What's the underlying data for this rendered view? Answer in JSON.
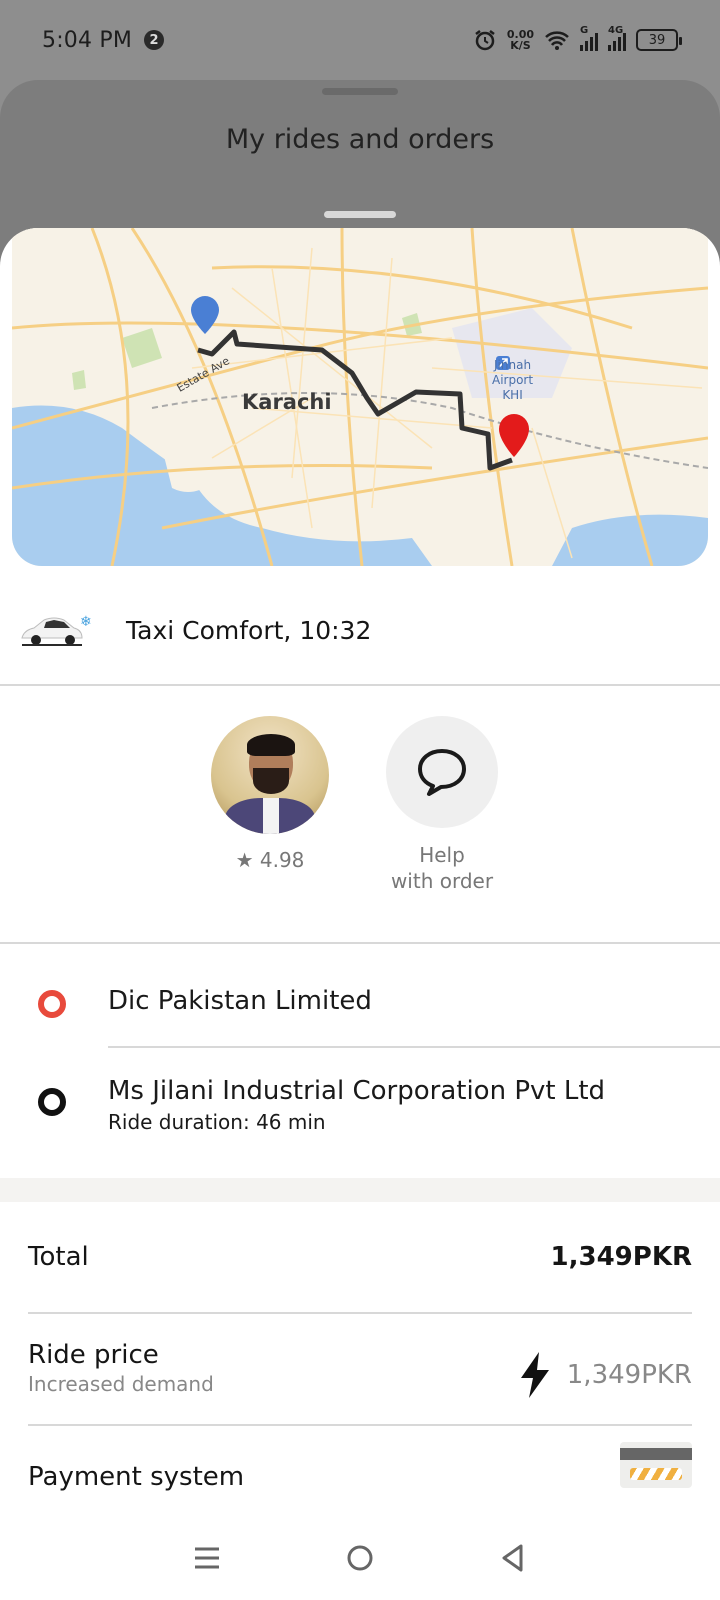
{
  "status_bar": {
    "time": "5:04 PM",
    "notification_count": "2",
    "net_speed_top": "0.00",
    "net_speed_bottom": "K/S",
    "sim1_label": "G",
    "sim2_label": "4G",
    "battery": "39"
  },
  "back_sheet": {
    "title": "My rides and orders"
  },
  "map": {
    "city_label": "Karachi",
    "street_label": "Estate Ave",
    "airport_line1": "Jinnah",
    "airport_line2": "Airport",
    "airport_line3": "KHI"
  },
  "service": {
    "label": "Taxi Comfort, 10:32"
  },
  "driver": {
    "rating": "★ 4.98"
  },
  "help": {
    "line1": "Help",
    "line2": "with order"
  },
  "route": {
    "from": "Dic Pakistan Limited",
    "to": "Ms Jilani Industrial Corporation Pvt Ltd",
    "duration": "Ride duration: 46 min"
  },
  "price": {
    "total_label": "Total",
    "total_value": "1,349PKR",
    "ride_price_label": "Ride price",
    "ride_price_sub": "Increased demand",
    "ride_price_value": "1,349PKR",
    "payment_label": "Payment system"
  },
  "colors": {
    "pickup": "#e84a3c",
    "route_line": "#333333",
    "start_pin": "#4a7fd4",
    "end_pin": "#e31b1b"
  }
}
